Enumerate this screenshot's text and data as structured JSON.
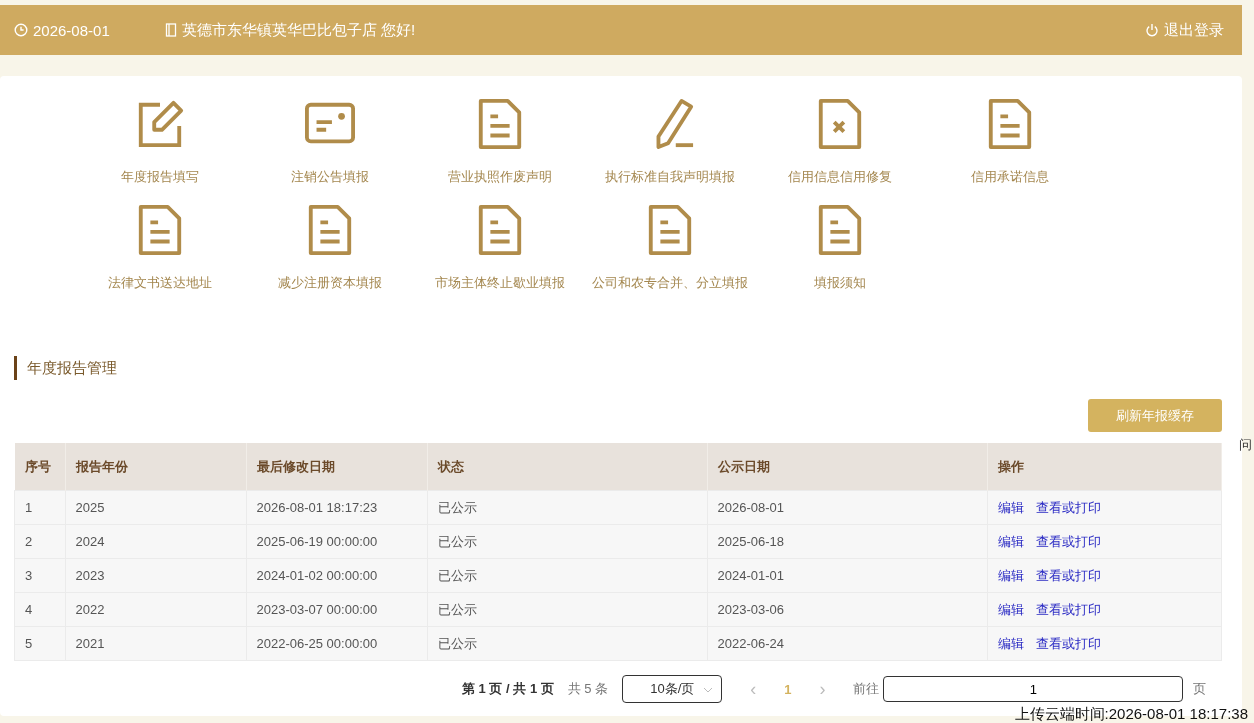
{
  "header": {
    "date": "2026-08-01",
    "greeting": "英德市东华镇英华巴比包子店 您好!",
    "logout": "退出登录"
  },
  "shortcuts": [
    {
      "label": "年度报告填写",
      "kind": "edit"
    },
    {
      "label": "注销公告填报",
      "kind": "card"
    },
    {
      "label": "营业执照作废声明",
      "kind": "doc"
    },
    {
      "label": "执行标准自我声明填报",
      "kind": "pencil"
    },
    {
      "label": "信用信息信用修复",
      "kind": "docx"
    },
    {
      "label": "信用承诺信息",
      "kind": "doc"
    },
    {
      "label": "法律文书送达地址",
      "kind": "doc"
    },
    {
      "label": "减少注册资本填报",
      "kind": "doc"
    },
    {
      "label": "市场主体终止歇业填报",
      "kind": "doc"
    },
    {
      "label": "公司和农专合并、分立填报",
      "kind": "doc"
    },
    {
      "label": "填报须知",
      "kind": "doc"
    }
  ],
  "section_title": "年度报告管理",
  "refresh_button": "刷新年报缓存",
  "side_note": "问",
  "table": {
    "columns": [
      "序号",
      "报告年份",
      "最后修改日期",
      "状态",
      "公示日期",
      "操作"
    ],
    "rows": [
      {
        "cells": [
          "1",
          "2025",
          "2026-08-01 18:17:23",
          "已公示",
          "2026-08-01"
        ],
        "actions": [
          "编辑",
          "查看或打印"
        ]
      },
      {
        "cells": [
          "2",
          "2024",
          "2025-06-19 00:00:00",
          "已公示",
          "2025-06-18"
        ],
        "actions": [
          "编辑",
          "查看或打印"
        ]
      },
      {
        "cells": [
          "3",
          "2023",
          "2024-01-02 00:00:00",
          "已公示",
          "2024-01-01"
        ],
        "actions": [
          "编辑",
          "查看或打印"
        ]
      },
      {
        "cells": [
          "4",
          "2022",
          "2023-03-07 00:00:00",
          "已公示",
          "2023-03-06"
        ],
        "actions": [
          "编辑",
          "查看或打印"
        ]
      },
      {
        "cells": [
          "5",
          "2021",
          "2022-06-25 00:00:00",
          "已公示",
          "2022-06-24"
        ],
        "actions": [
          "编辑",
          "查看或打印"
        ]
      }
    ]
  },
  "pagination": {
    "summary": "第 1 页 / 共 1 页",
    "total": "共 5 条",
    "page_size": "10条/页",
    "prev": "‹",
    "pages": [
      {
        "label": "1",
        "selected": true
      }
    ],
    "next": "›",
    "goto_label": "前往",
    "goto_value": "1",
    "goto_suffix": "页"
  },
  "upload_time": "上传云端时间:2026-08-01 18:17:38"
}
